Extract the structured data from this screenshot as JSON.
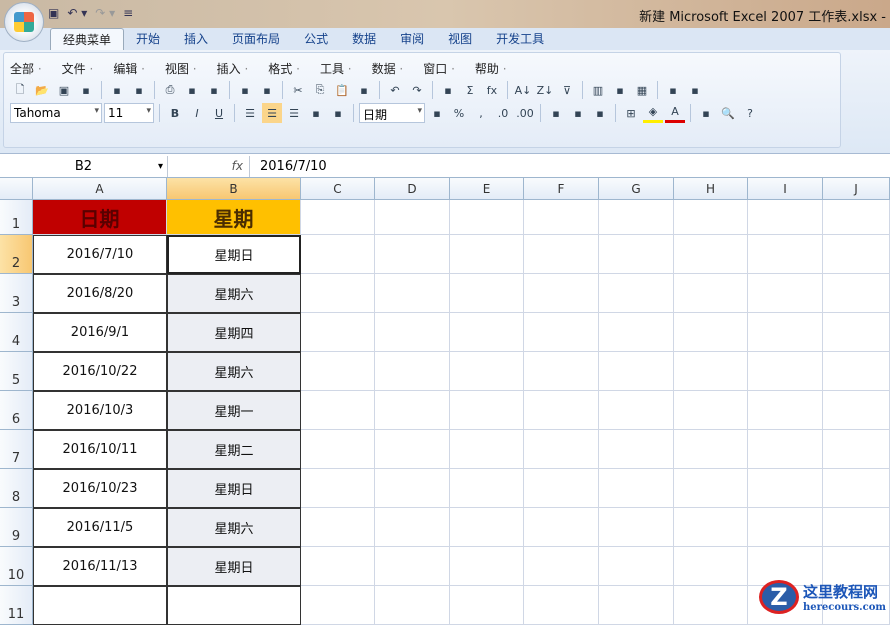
{
  "window": {
    "title": "新建 Microsoft Excel 2007 工作表.xlsx -"
  },
  "tabs": [
    "经典菜单",
    "开始",
    "插入",
    "页面布局",
    "公式",
    "数据",
    "审阅",
    "视图",
    "开发工具"
  ],
  "menus": [
    "全部",
    "文件",
    "编辑",
    "视图",
    "插入",
    "格式",
    "工具",
    "数据",
    "窗口",
    "帮助"
  ],
  "toolbar1": [
    "new-icon",
    "open-icon",
    "save-icon",
    "excel-icon",
    "|",
    "print-preview-icon",
    "permission-icon",
    "|",
    "print-icon",
    "preview-icon",
    "research-icon",
    "|",
    "spelling-icon",
    "thesaurus-icon",
    "|",
    "cut-icon",
    "copy-icon",
    "paste-icon",
    "format-painter-icon",
    "|",
    "undo-icon",
    "redo-icon",
    "|",
    "hyperlink-icon",
    "sum-icon",
    "function-icon",
    "|",
    "sort-asc-icon",
    "sort-desc-icon",
    "filter-icon",
    "|",
    "chart-icon",
    "shapes-icon",
    "table-icon",
    "|",
    "comment-icon",
    "macro-icon"
  ],
  "font": {
    "name": "Tahoma",
    "size": "11"
  },
  "toolbar2a": [
    "bold-icon",
    "italic-icon",
    "underline-icon",
    "|",
    "align-left-icon",
    "align-center-icon",
    "align-right-icon",
    "merge-center-icon",
    "wrap-text-icon"
  ],
  "number_format": "日期",
  "toolbar2b": [
    "currency-icon",
    "percent-icon",
    "comma-icon",
    "increase-decimal-icon",
    "decrease-decimal-icon",
    "|",
    "decrease-indent-icon",
    "increase-indent-icon",
    "cell-style-icon",
    "|",
    "borders-icon",
    "fill-color-icon",
    "font-color-icon",
    "|",
    "picture-icon",
    "zoom-icon",
    "help-icon"
  ],
  "formula_bar": {
    "name_box": "B2",
    "fx": "fx",
    "value": "2016/7/10"
  },
  "columns": [
    "A",
    "B",
    "C",
    "D",
    "E",
    "F",
    "G",
    "H",
    "I",
    "J"
  ],
  "rows": [
    "1",
    "2",
    "3",
    "4",
    "5",
    "6",
    "7",
    "8",
    "9",
    "10",
    "11"
  ],
  "headers": {
    "a": "日期",
    "b": "星期"
  },
  "data": [
    {
      "date": "2016/7/10",
      "weekday": "星期日"
    },
    {
      "date": "2016/8/20",
      "weekday": "星期六"
    },
    {
      "date": "2016/9/1",
      "weekday": "星期四"
    },
    {
      "date": "2016/10/22",
      "weekday": "星期六"
    },
    {
      "date": "2016/10/3",
      "weekday": "星期一"
    },
    {
      "date": "2016/10/11",
      "weekday": "星期二"
    },
    {
      "date": "2016/10/23",
      "weekday": "星期日"
    },
    {
      "date": "2016/11/5",
      "weekday": "星期六"
    },
    {
      "date": "2016/11/13",
      "weekday": "星期日"
    }
  ],
  "watermark": {
    "name": "这里教程网",
    "url": "herecours.com"
  }
}
